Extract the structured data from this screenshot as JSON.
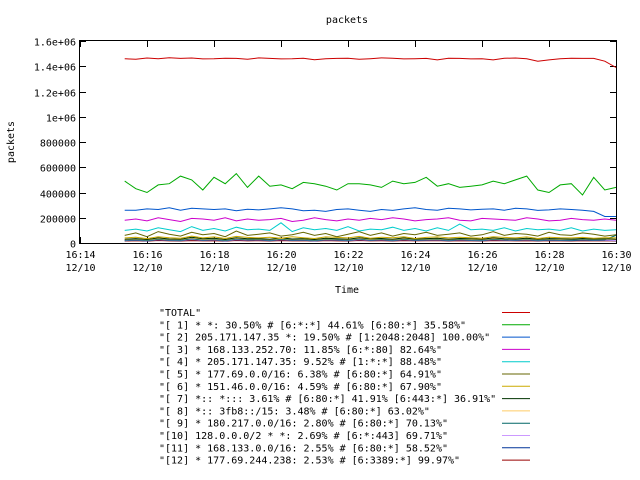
{
  "chart_data": {
    "type": "line",
    "title": "packets",
    "xlabel": "Time",
    "ylabel": "packets",
    "ylim": [
      0,
      1600000
    ],
    "y_ticks": [
      "0",
      "200000",
      "400000",
      "600000",
      "800000",
      "1e+06",
      "1.2e+06",
      "1.4e+06",
      "1.6e+06"
    ],
    "x_ticks": [
      {
        "time": "16:14",
        "date": "12/10"
      },
      {
        "time": "16:16",
        "date": "12/10"
      },
      {
        "time": "16:18",
        "date": "12/10"
      },
      {
        "time": "16:20",
        "date": "12/10"
      },
      {
        "time": "16:22",
        "date": "12/10"
      },
      {
        "time": "16:24",
        "date": "12/10"
      },
      {
        "time": "16:26",
        "date": "12/10"
      },
      {
        "time": "16:28",
        "date": "12/10"
      },
      {
        "time": "16:30",
        "date": "12/10"
      }
    ],
    "x_range": [
      "16:14",
      "16:30"
    ],
    "grid": false,
    "legend_position": "bottom",
    "x": [
      "16:15:20",
      "16:15:40",
      "16:16:00",
      "16:16:20",
      "16:16:40",
      "16:17:00",
      "16:17:20",
      "16:17:40",
      "16:18:00",
      "16:18:20",
      "16:18:40",
      "16:19:00",
      "16:19:20",
      "16:19:40",
      "16:20:00",
      "16:20:20",
      "16:20:40",
      "16:21:00",
      "16:21:20",
      "16:21:40",
      "16:22:00",
      "16:22:20",
      "16:22:40",
      "16:23:00",
      "16:23:20",
      "16:23:40",
      "16:24:00",
      "16:24:20",
      "16:24:40",
      "16:25:00",
      "16:25:20",
      "16:25:40",
      "16:26:00",
      "16:26:20",
      "16:26:40",
      "16:27:00",
      "16:27:20",
      "16:27:40",
      "16:28:00",
      "16:28:20",
      "16:28:40",
      "16:29:00",
      "16:29:20",
      "16:29:40",
      "16:30:00"
    ],
    "series": [
      {
        "name": "\"TOTAL\"",
        "color": "#cc0000",
        "values": [
          1460000,
          1455000,
          1465000,
          1460000,
          1468000,
          1462000,
          1465000,
          1458000,
          1460000,
          1464000,
          1462000,
          1455000,
          1466000,
          1462000,
          1458000,
          1460000,
          1464000,
          1452000,
          1460000,
          1462000,
          1464000,
          1455000,
          1460000,
          1466000,
          1464000,
          1458000,
          1460000,
          1462000,
          1450000,
          1464000,
          1462000,
          1458000,
          1460000,
          1450000,
          1463000,
          1465000,
          1460000,
          1440000,
          1450000,
          1460000,
          1464000,
          1462000,
          1462000,
          1440000,
          1390000
        ]
      },
      {
        "name": "\"[ 1] * *: 30.50% # [6:*:*] 44.61% [6:80:*] 35.58%\"",
        "color": "#00aa00",
        "values": [
          490000,
          430000,
          400000,
          460000,
          470000,
          530000,
          500000,
          420000,
          520000,
          470000,
          550000,
          440000,
          530000,
          450000,
          460000,
          430000,
          480000,
          470000,
          450000,
          420000,
          470000,
          470000,
          460000,
          440000,
          490000,
          470000,
          480000,
          520000,
          450000,
          470000,
          440000,
          450000,
          460000,
          490000,
          470000,
          500000,
          530000,
          420000,
          400000,
          460000,
          470000,
          380000,
          520000,
          420000,
          440000
        ]
      },
      {
        "name": "\"[ 2] 205.171.147.35 *: 19.50% # [1:2048:2048] 100.00%\"",
        "color": "#0055cc",
        "values": [
          260000,
          260000,
          270000,
          265000,
          280000,
          260000,
          275000,
          270000,
          265000,
          270000,
          255000,
          268000,
          262000,
          270000,
          280000,
          270000,
          255000,
          260000,
          250000,
          265000,
          270000,
          260000,
          250000,
          265000,
          258000,
          270000,
          280000,
          265000,
          260000,
          275000,
          270000,
          262000,
          268000,
          270000,
          260000,
          275000,
          270000,
          258000,
          262000,
          270000,
          265000,
          260000,
          250000,
          210000,
          210000
        ]
      },
      {
        "name": "\"[ 3] * 168.133.252.70: 11.85% [6:*:80] 82.64%\"",
        "color": "#cc00cc",
        "values": [
          180000,
          190000,
          175000,
          200000,
          185000,
          170000,
          195000,
          190000,
          180000,
          200000,
          175000,
          190000,
          180000,
          185000,
          195000,
          170000,
          180000,
          200000,
          185000,
          175000,
          190000,
          180000,
          195000,
          185000,
          200000,
          190000,
          175000,
          185000,
          190000,
          200000,
          180000,
          175000,
          195000,
          190000,
          185000,
          180000,
          200000,
          190000,
          175000,
          180000,
          195000,
          185000,
          180000,
          190000,
          180000
        ]
      },
      {
        "name": "\"[ 4] * 205.171.147.35: 9.52% # [1:*:*] 88.48%\"",
        "color": "#00cccc",
        "values": [
          100000,
          110000,
          95000,
          120000,
          105000,
          90000,
          130000,
          100000,
          115000,
          95000,
          125000,
          105000,
          110000,
          100000,
          160000,
          90000,
          120000,
          105000,
          115000,
          100000,
          130000,
          95000,
          110000,
          105000,
          125000,
          100000,
          115000,
          95000,
          120000,
          100000,
          150000,
          105000,
          110000,
          100000,
          120000,
          95000,
          115000,
          105000,
          110000,
          100000,
          120000,
          95000,
          110000,
          100000,
          105000
        ]
      },
      {
        "name": "\"[ 5] * 177.69.0.0/16: 6.38% # [6:80:*] 64.91%\"",
        "color": "#666600",
        "values": [
          60000,
          80000,
          50000,
          90000,
          70000,
          55000,
          85000,
          65000,
          75000,
          50000,
          95000,
          60000,
          70000,
          80000,
          55000,
          65000,
          85000,
          60000,
          75000,
          50000,
          70000,
          90000,
          60000,
          80000,
          55000,
          75000,
          65000,
          85000,
          60000,
          70000,
          80000,
          55000,
          65000,
          90000,
          60000,
          75000,
          70000,
          55000,
          85000,
          65000,
          60000,
          80000,
          70000,
          55000,
          65000
        ]
      },
      {
        "name": "\"[ 6] * 151.46.0.0/16: 4.59% # [6:80:*] 67.90%\"",
        "color": "#ccaa00",
        "values": [
          40000,
          45000,
          35000,
          50000,
          42000,
          38000,
          55000,
          40000,
          48000,
          36000,
          52000,
          44000,
          40000,
          46000,
          38000,
          50000,
          42000,
          36000,
          48000,
          44000,
          40000,
          52000,
          38000,
          46000,
          42000,
          50000,
          36000,
          44000,
          48000,
          40000,
          46000,
          42000,
          38000,
          50000,
          44000,
          40000,
          48000,
          36000,
          46000,
          42000,
          40000,
          44000,
          38000,
          42000,
          40000
        ]
      },
      {
        "name": "\"[ 7] *:: *::: 3.61% # [6:80:*] 41.91% [6:443:*] 36.91%\"",
        "color": "#003300",
        "values": [
          30000,
          35000,
          28000,
          40000,
          32000,
          30000,
          45000,
          33000,
          38000,
          28000,
          42000,
          34000,
          36000,
          30000,
          40000,
          32000,
          35000,
          28000,
          38000,
          34000,
          30000,
          42000,
          33000,
          36000,
          30000,
          40000,
          32000,
          35000,
          38000,
          30000,
          36000,
          33000,
          30000,
          40000,
          34000,
          32000,
          38000,
          30000,
          35000,
          33000,
          31000,
          36000,
          32000,
          34000,
          30000
        ]
      },
      {
        "name": "\"[ 8] *:: 3fb8::/15: 3.48% # [6:80:*] 63.02%\"",
        "color": "#ffcc66",
        "values": [
          28000,
          32000,
          26000,
          36000,
          30000,
          28000,
          40000,
          30000,
          34000,
          26000,
          38000,
          32000,
          34000,
          28000,
          36000,
          30000,
          32000,
          26000,
          34000,
          32000,
          28000,
          38000,
          30000,
          34000,
          28000,
          36000,
          30000,
          32000,
          34000,
          28000,
          34000,
          30000,
          28000,
          36000,
          32000,
          30000,
          34000,
          28000,
          32000,
          30000,
          29000,
          33000,
          30000,
          32000,
          28000
        ]
      },
      {
        "name": "\"[ 9] * 180.217.0.0/16: 2.80% # [6:80:*] 70.13%\"",
        "color": "#006666",
        "values": [
          22000,
          26000,
          20000,
          30000,
          24000,
          22000,
          34000,
          24000,
          28000,
          20000,
          32000,
          26000,
          28000,
          22000,
          30000,
          24000,
          26000,
          20000,
          28000,
          26000,
          22000,
          32000,
          24000,
          28000,
          22000,
          30000,
          24000,
          26000,
          28000,
          22000,
          28000,
          24000,
          22000,
          30000,
          26000,
          24000,
          28000,
          22000,
          26000,
          24000,
          23000,
          27000,
          24000,
          26000,
          60000
        ]
      },
      {
        "name": "\"[10] 128.0.0.0/2 * *: 2.69% # [6:*:443] 69.71%\"",
        "color": "#cc99ff",
        "values": [
          20000,
          24000,
          18000,
          28000,
          22000,
          20000,
          30000,
          22000,
          26000,
          18000,
          28000,
          24000,
          26000,
          20000,
          28000,
          22000,
          24000,
          18000,
          26000,
          24000,
          20000,
          28000,
          22000,
          26000,
          20000,
          28000,
          22000,
          24000,
          26000,
          20000,
          26000,
          22000,
          20000,
          28000,
          24000,
          22000,
          26000,
          20000,
          24000,
          22000,
          21000,
          25000,
          22000,
          24000,
          20000
        ]
      },
      {
        "name": "\"[11] * 168.133.0.0/16: 2.55% # [6:80:*] 58.52%\"",
        "color": "#003399",
        "values": [
          18000,
          22000,
          16000,
          26000,
          20000,
          18000,
          28000,
          20000,
          24000,
          16000,
          26000,
          22000,
          24000,
          18000,
          26000,
          20000,
          22000,
          16000,
          24000,
          22000,
          18000,
          26000,
          20000,
          24000,
          18000,
          26000,
          20000,
          22000,
          24000,
          18000,
          24000,
          20000,
          18000,
          26000,
          22000,
          20000,
          24000,
          18000,
          22000,
          20000,
          19000,
          23000,
          20000,
          22000,
          18000
        ]
      },
      {
        "name": "\"[12] * 177.69.244.238: 2.53% # [6:3389:*] 99.97%\"",
        "color": "#990000",
        "values": [
          16000,
          18000,
          15000,
          20000,
          17000,
          16000,
          19000,
          17000,
          18000,
          15000,
          20000,
          17000,
          18000,
          16000,
          19000,
          17000,
          18000,
          15000,
          19000,
          17000,
          16000,
          20000,
          17000,
          18000,
          16000,
          19000,
          17000,
          18000,
          19000,
          16000,
          18000,
          17000,
          16000,
          19000,
          18000,
          17000,
          18000,
          16000,
          18000,
          17000,
          16000,
          18000,
          17000,
          18000,
          16000
        ]
      }
    ]
  }
}
